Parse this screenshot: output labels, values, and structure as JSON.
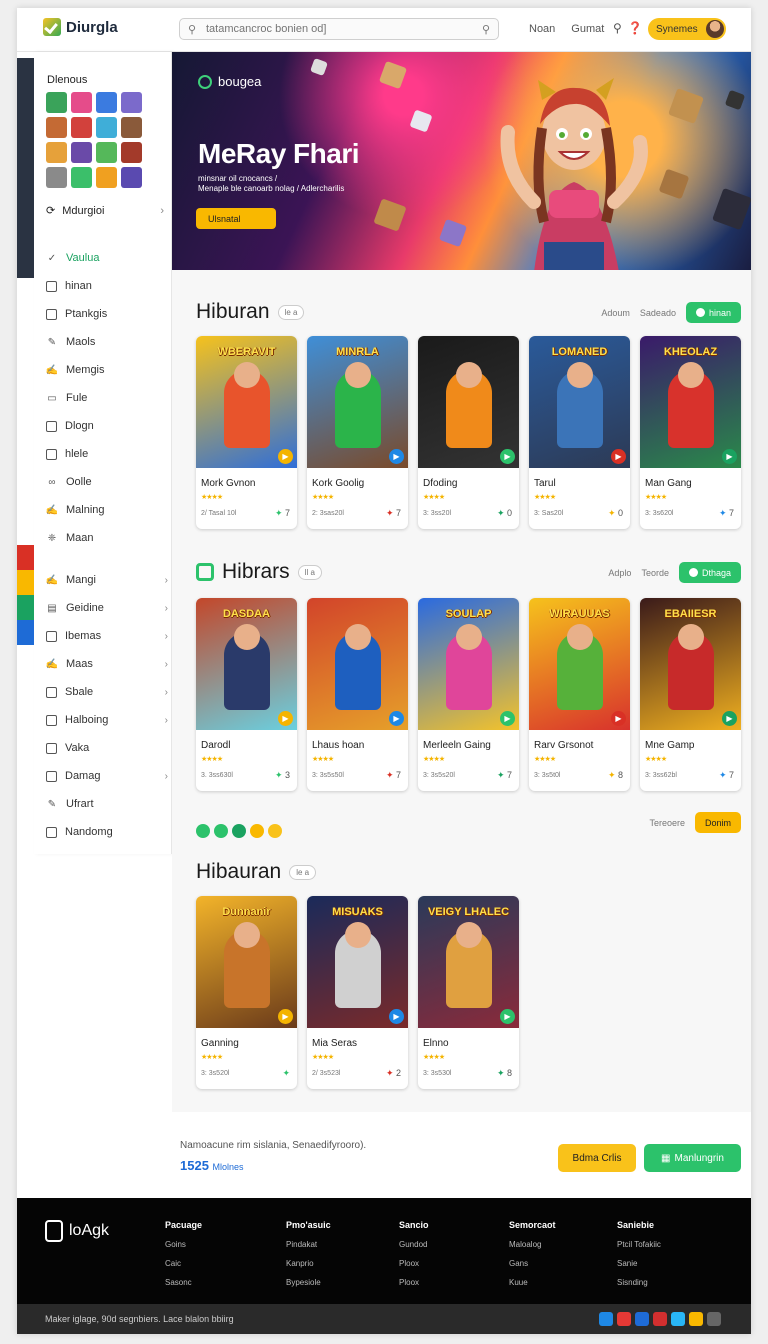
{
  "header": {
    "logo_text": "Diurgla",
    "search_placeholder": "tatamcancroc bonien od]",
    "nav": [
      "Noan",
      "Gumat"
    ],
    "action_label": "Synemes"
  },
  "sidebar": {
    "title": "Dlenous",
    "more_label": "Mdurgioi",
    "items": [
      {
        "label": "Vaulua",
        "icon": "check-icon",
        "active": true,
        "chevron": false
      },
      {
        "label": "hinan",
        "icon": "square-icon",
        "chevron": false
      },
      {
        "label": "Ptankgis",
        "icon": "square-icon",
        "chevron": false
      },
      {
        "label": "Maols",
        "icon": "pencil-icon",
        "chevron": false
      },
      {
        "label": "Memgis",
        "icon": "edit-icon",
        "chevron": false
      },
      {
        "label": "Fule",
        "icon": "folder-icon",
        "chevron": false
      },
      {
        "label": "Dlogn",
        "icon": "square-icon",
        "chevron": false
      },
      {
        "label": "hlele",
        "icon": "square-icon",
        "chevron": false
      },
      {
        "label": "Oolle",
        "icon": "link-icon",
        "chevron": false
      },
      {
        "label": "Malning",
        "icon": "edit-icon",
        "chevron": false
      },
      {
        "label": "Maan",
        "icon": "puzzle-icon",
        "chevron": false
      },
      {
        "label": "Mangi",
        "icon": "edit-icon",
        "chevron": true
      },
      {
        "label": "Geidine",
        "icon": "calendar-icon",
        "chevron": true
      },
      {
        "label": "Ibemas",
        "icon": "square-icon",
        "chevron": true
      },
      {
        "label": "Maas",
        "icon": "edit-icon",
        "chevron": true
      },
      {
        "label": "Sbale",
        "icon": "square-icon",
        "chevron": true
      },
      {
        "label": "Halboing",
        "icon": "square-icon",
        "chevron": true
      },
      {
        "label": "Vaka",
        "icon": "square-icon",
        "chevron": false
      },
      {
        "label": "Damag",
        "icon": "square-icon",
        "chevron": true
      },
      {
        "label": "Ufrart",
        "icon": "pencil-icon",
        "chevron": false
      },
      {
        "label": "Nandomg",
        "icon": "square-icon",
        "chevron": false
      }
    ]
  },
  "hero": {
    "brand": "bougea",
    "title": "MeRay Fhari",
    "subtitle_1": "minsnar oil cnocancs /",
    "subtitle_2": "Menaple ble canoarb nolag / Adlercharilis",
    "cta": "Ulsnatal"
  },
  "sections": [
    {
      "title": "Hiburan",
      "pill": "le a",
      "right_links": [
        "Adoum",
        "Sadeado"
      ],
      "button": "hinan",
      "cards": [
        {
          "art_title": "WBERAVIT",
          "name": "Mork Gvnon",
          "meta": "2/ Tasal 10l",
          "count": "7"
        },
        {
          "art_title": "MINRLA",
          "name": "Kork Goolig",
          "meta": "2: 3sas20l",
          "count": "7"
        },
        {
          "art_title": "",
          "name": "Dfoding",
          "meta": "3: 3ss20l",
          "count": "0"
        },
        {
          "art_title": "LOMANED",
          "name": "Tarul",
          "meta": "3: Sas20l",
          "count": "0"
        },
        {
          "art_title": "KHEOLAZ",
          "name": "Man Gang",
          "meta": "3: 3s620l",
          "count": "7"
        }
      ]
    },
    {
      "title": "Hibrars",
      "pill": "ll a",
      "right_links": [
        "Adplo",
        "Teorde"
      ],
      "button": "Dthaga",
      "cards": [
        {
          "art_title": "DASDAA",
          "name": "Darodl",
          "meta": "3. 3ss630l",
          "count": "3"
        },
        {
          "art_title": "",
          "name": "Lhaus hoan",
          "meta": "3: 3s5s50l",
          "count": "7"
        },
        {
          "art_title": "SOULAP",
          "name": "Merleeln Gaing",
          "meta": "3: 3s5s20l",
          "count": "7"
        },
        {
          "art_title": "WIRAUUAS",
          "name": "Rarv Grsonot",
          "meta": "3: 3s5t0l",
          "count": "8"
        },
        {
          "art_title": "EBAIIESR",
          "name": "Mne Gamp",
          "meta": "3: 3ss62bl",
          "count": "7"
        }
      ]
    },
    {
      "title": "Hibauran",
      "pill": "le a",
      "right_links": [
        "Tereoere"
      ],
      "button": "Donim",
      "cards": [
        {
          "art_title": "Dunnanir",
          "name": "Ganning",
          "meta": "3: 3s520l",
          "count": ""
        },
        {
          "art_title": "MISUAKS",
          "name": "Mia Seras",
          "meta": "2/ 3s523l",
          "count": "2"
        },
        {
          "art_title": "VEIGY LHALEC",
          "name": "Elnno",
          "meta": "3: 3s530l",
          "count": "8"
        }
      ]
    }
  ],
  "summary": {
    "text": "Namoacune rim sislania, Senaedifyrooro).",
    "count": "1525",
    "count_unit": "Mlolnes",
    "btn1": "Bdma Crlis",
    "btn2": "Manlungrin"
  },
  "footer": {
    "logo": "loAgk",
    "columns": [
      {
        "heading": "Pacuage",
        "links": [
          "Goins",
          "Caic",
          "Sasonc"
        ]
      },
      {
        "heading": "Pmo'asuic",
        "links": [
          "Pindakat",
          "Kanprio",
          "Bypesiole"
        ]
      },
      {
        "heading": "Sancio",
        "links": [
          "Gundod",
          "Ploox",
          "Ploox"
        ]
      },
      {
        "heading": "Semorcaot",
        "links": [
          "Maloalog",
          "Gans",
          "Kuue"
        ]
      },
      {
        "heading": "Saniebie",
        "links": [
          "Ptcil Tofakiic",
          "Sanie",
          "Sisnding"
        ]
      }
    ],
    "bottom_text": "Maker iglage, 90d segnbiers. Lace blalon bbiirg"
  },
  "colors": {
    "green": "#2cc26b",
    "yellow": "#f9c21a",
    "blue": "#1e6bd6",
    "footer": "#050505"
  }
}
